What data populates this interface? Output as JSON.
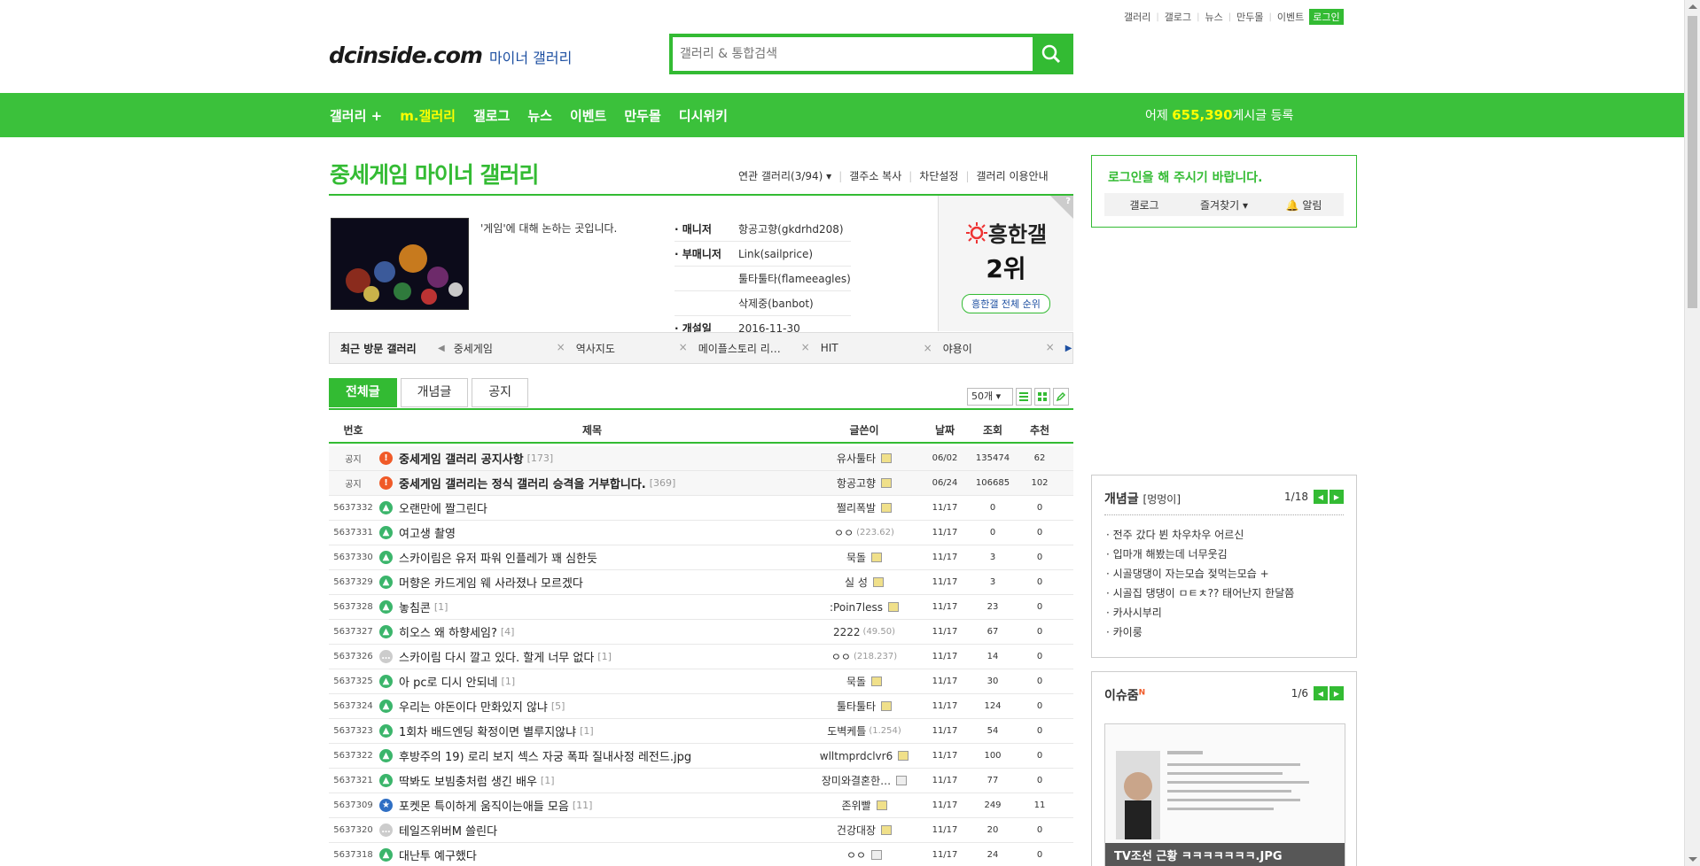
{
  "util_links": [
    "갤러리",
    "갤로그",
    "뉴스",
    "만두몰",
    "이벤트"
  ],
  "util_login": "로그인",
  "logo": {
    "brand": "dcinside.com",
    "sub": "마이너 갤러리"
  },
  "search": {
    "placeholder": "갤러리 & 통합검색"
  },
  "gnb": {
    "items": [
      "갤러리 +",
      "m.갤러리",
      "갤로그",
      "뉴스",
      "이벤트",
      "만두몰",
      "디시위키"
    ],
    "stat_prefix": "어제",
    "stat_num": "655,390",
    "stat_suffix": "게시글 등록"
  },
  "gallery": {
    "title": "중세게임 마이너 갤러리",
    "menu": [
      "연관 갤러리(3/94)",
      "갤주소 복사",
      "차단설정",
      "갤러리 이용안내"
    ],
    "desc": "'게임'에 대해 논하는 곳입니다.",
    "staff": [
      {
        "k": "매니저",
        "v": [
          "항공고향(gkdrhd208)"
        ]
      },
      {
        "k": "부매니저",
        "v": [
          "Link(sailprice)",
          "툴타툴타(flameeagles)",
          "삭제중(banbot)"
        ]
      },
      {
        "k": "개설일",
        "v": [
          "2016-11-30"
        ]
      }
    ],
    "rank_label": "흥한갤",
    "rank_value": "2위",
    "rank_button": "흥한갤 전체 순위",
    "rank_q": "?"
  },
  "recent": {
    "label": "최근 방문 갤러리",
    "items": [
      "중세게임",
      "역사지도",
      "메이플스토리 리…",
      "HIT",
      "야용이"
    ]
  },
  "tabs": [
    "전체글",
    "개념글",
    "공지"
  ],
  "list_count": "50개",
  "columns": {
    "num": "번호",
    "subject": "제목",
    "writer": "글쓴이",
    "date": "날짜",
    "views": "조회",
    "rec": "추천"
  },
  "rows": [
    {
      "num": "공지",
      "type": "notice",
      "subject": "중세게임 갤러리 공지사항",
      "cmt": "[173]",
      "writer": "유사툴타",
      "ip": "",
      "badge": "y",
      "date": "06/02",
      "views": "135474",
      "rec": "62"
    },
    {
      "num": "공지",
      "type": "notice",
      "subject": "중세게임 갤러리는 정식 갤러리 승격을 거부합니다.",
      "cmt": "[369]",
      "writer": "항공고향",
      "ip": "",
      "badge": "y",
      "date": "06/24",
      "views": "106685",
      "rec": "102"
    },
    {
      "num": "5637332",
      "type": "txt",
      "subject": "오랜만에 짤그린다",
      "cmt": "",
      "writer": "쩔리폭발",
      "ip": "",
      "badge": "y",
      "date": "11/17",
      "views": "0",
      "rec": "0"
    },
    {
      "num": "5637331",
      "type": "txt",
      "subject": "여고생 촬영",
      "cmt": "",
      "writer": "ㅇㅇ",
      "ip": "(223.62)",
      "badge": "",
      "date": "11/17",
      "views": "0",
      "rec": "0"
    },
    {
      "num": "5637330",
      "type": "txt",
      "subject": "스카이림은 유저 파워 인플레가 꽤 심한듯",
      "cmt": "",
      "writer": "묵돌",
      "ip": "",
      "badge": "y",
      "date": "11/17",
      "views": "3",
      "rec": "0"
    },
    {
      "num": "5637329",
      "type": "txt",
      "subject": "머향온 카드게임 웨 사라졌나 모르겠다",
      "cmt": "",
      "writer": "실 성",
      "ip": "",
      "badge": "y",
      "date": "11/17",
      "views": "3",
      "rec": "0"
    },
    {
      "num": "5637328",
      "type": "txt",
      "subject": "놓침콘",
      "cmt": "[1]",
      "writer": ":Poin7less",
      "ip": "",
      "badge": "y",
      "date": "11/17",
      "views": "23",
      "rec": "0"
    },
    {
      "num": "5637327",
      "type": "txt",
      "subject": "히오스 왜 하향세임?",
      "cmt": "[4]",
      "writer": "2222",
      "ip": "(49.50)",
      "badge": "",
      "date": "11/17",
      "views": "67",
      "rec": "0"
    },
    {
      "num": "5637326",
      "type": "cmt2",
      "subject": "스카이림 다시 깔고 있다. 할게 너무 없다",
      "cmt": "[1]",
      "writer": "ㅇㅇ",
      "ip": "(218.237)",
      "badge": "",
      "date": "11/17",
      "views": "14",
      "rec": "0"
    },
    {
      "num": "5637325",
      "type": "txt",
      "subject": "아 pc로 디시 안되네",
      "cmt": "[1]",
      "writer": "묵돌",
      "ip": "",
      "badge": "y",
      "date": "11/17",
      "views": "30",
      "rec": "0"
    },
    {
      "num": "5637324",
      "type": "txt",
      "subject": "우리는 야돈이다 만화있지 않냐",
      "cmt": "[5]",
      "writer": "툴타툴타",
      "ip": "",
      "badge": "y",
      "date": "11/17",
      "views": "124",
      "rec": "0"
    },
    {
      "num": "5637323",
      "type": "txt",
      "subject": "1회차 배드엔딩 확정이면 별루지않냐",
      "cmt": "[1]",
      "writer": "도벽케틀",
      "ip": "(1.254)",
      "badge": "",
      "date": "11/17",
      "views": "54",
      "rec": "0"
    },
    {
      "num": "5637322",
      "type": "txt",
      "subject": "후방주의 19) 로리 보지 섹스 자궁 폭파 질내사정 레전드.jpg",
      "cmt": "",
      "writer": "wlltmprdclvr6",
      "ip": "",
      "badge": "y",
      "date": "11/17",
      "views": "100",
      "rec": "0"
    },
    {
      "num": "5637321",
      "type": "txt",
      "subject": "딱봐도 보빔충처럼 생긴 배우",
      "cmt": "[1]",
      "writer": "장미와결혼한…",
      "ip": "",
      "badge": "g",
      "date": "11/17",
      "views": "77",
      "rec": "0"
    },
    {
      "num": "5637309",
      "type": "star",
      "subject": "포켓몬 특이하게 움직이는애들 모음",
      "cmt": "[11]",
      "writer": "존위빨",
      "ip": "",
      "badge": "y",
      "date": "11/17",
      "views": "249",
      "rec": "11"
    },
    {
      "num": "5637320",
      "type": "cmt2",
      "subject": "테일즈위버M 쓸린다",
      "cmt": "",
      "writer": "건강대장",
      "ip": "",
      "badge": "y",
      "date": "11/17",
      "views": "20",
      "rec": "0"
    },
    {
      "num": "5637318",
      "type": "txt",
      "subject": "대난투 예구했다",
      "cmt": "",
      "writer": "ㅇㅇ",
      "ip": "",
      "badge": "g",
      "date": "11/17",
      "views": "24",
      "rec": "0"
    }
  ],
  "right": {
    "login_msg": "로그인을 해 주시기 바랍니다.",
    "login_acts": [
      "갤로그",
      "즐겨찾기",
      "알림"
    ],
    "concept_title": "개념글",
    "concept_sub": "[멍멍이]",
    "concept_page": "1/18",
    "concept_items": [
      "전주 갔다 뷘 차우차우 어르신",
      "입마개 해봤는데 너무웃김",
      "시골댕댕이 자는모습 젖먹는모습 +",
      "시골집 댕댕이 ㅁㅌㅊ?? 태어난지 한달쯤",
      "카사시부리",
      "카이룽"
    ],
    "issue_title": "이슈줌",
    "issue_sup": "N",
    "issue_page": "1/6",
    "issue_caption": "TV조선 근황 ㅋㅋㅋㅋㅋㅋㅋ.JPG"
  }
}
